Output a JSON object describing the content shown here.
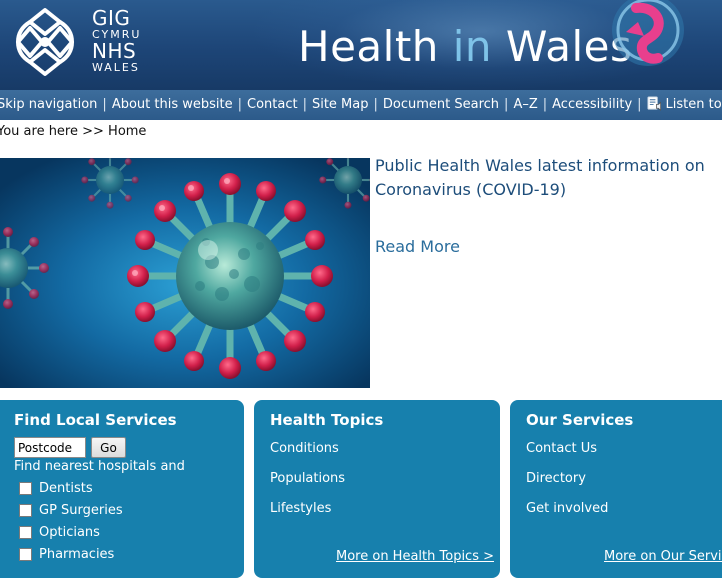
{
  "header": {
    "logo": {
      "line1": "GIG",
      "line2": "CYMRU",
      "line3": "NHS",
      "line4": "WALES"
    },
    "title_part1": "Health ",
    "title_part2": "in",
    "title_part3": " Wales",
    "colors": {
      "header_bg": "#1d4577",
      "accent": "#7fc3e8"
    }
  },
  "nav": {
    "items": [
      "Skip navigation",
      "About this website",
      "Contact",
      "Site Map",
      "Document Search",
      "A–Z",
      "Accessibility",
      "Listen to this page"
    ],
    "separator": "|",
    "listen_icon": "speaker-icon"
  },
  "breadcrumb": {
    "text": "You are here >> Home"
  },
  "hero": {
    "image": "coronavirus-illustration",
    "title": "Public Health Wales latest information on Coronavirus (COVID‑19)",
    "read_more": "Read More"
  },
  "panels": {
    "find_local": {
      "title": "Find Local Services",
      "postcode_value": "Postcode",
      "go_label": "Go",
      "find_text": "Find nearest hospitals and",
      "options": [
        "Dentists",
        "GP Surgeries",
        "Opticians",
        "Pharmacies"
      ]
    },
    "health_topics": {
      "title": "Health Topics",
      "links": [
        "Conditions",
        "Populations",
        "Lifestyles"
      ],
      "more": "More on Health Topics >"
    },
    "our_services": {
      "title": "Our Services",
      "links": [
        "Contact Us",
        "Directory",
        "Get involved"
      ],
      "more": "More on Our Services >"
    },
    "panel_color": "#1780ad"
  }
}
